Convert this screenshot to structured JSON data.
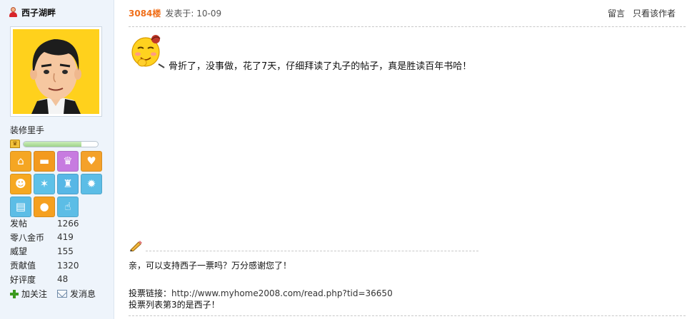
{
  "user": {
    "username": "西子湖畔",
    "title": "装修里手",
    "level_progress": 0.78,
    "medals": [
      {
        "icon": "house-icon",
        "color": "#f5a623"
      },
      {
        "icon": "sofa-icon",
        "color": "#f39a1e"
      },
      {
        "icon": "crown-icon",
        "color": "#c77be0"
      },
      {
        "icon": "heart-icon",
        "color": "#f4a12a"
      },
      {
        "icon": "bee-icon",
        "color": "#f6a821"
      },
      {
        "icon": "angel-icon",
        "color": "#5ec1e8"
      },
      {
        "icon": "trophy-icon",
        "color": "#57b7e6"
      },
      {
        "icon": "torch-icon",
        "color": "#5cbde6"
      },
      {
        "icon": "book-icon",
        "color": "#5cbde6"
      },
      {
        "icon": "water-drop-icon",
        "color": "#f5a020"
      },
      {
        "icon": "thumbs-up-icon",
        "color": "#5cbde6"
      }
    ],
    "stats": [
      {
        "label": "发帖",
        "value": "1266"
      },
      {
        "label": "零八金币",
        "value": "419"
      },
      {
        "label": "威望",
        "value": "155"
      },
      {
        "label": "贡献值",
        "value": "1320"
      },
      {
        "label": "好评度",
        "value": "48"
      }
    ],
    "actions": {
      "follow": "加关注",
      "message": "发消息"
    }
  },
  "post": {
    "floor": "3084楼",
    "posted": "发表于: 10-09",
    "links": {
      "reply": "留言",
      "only_author": "只看该作者"
    },
    "content": "骨折了，没事做，花了7天，仔细拜读了丸子的帖子，真是胜读百年书哈！",
    "signature": {
      "line1": "亲，可以支持西子一票吗？万分感谢您了！",
      "vote_label": "投票链接：",
      "vote_url": "http://www.myhome2008.com/read.php?tid=36650",
      "line3": "投票列表第3的是西子！"
    }
  },
  "colors": {
    "accent_orange": "#f06f1a",
    "sidebar_bg": "#eef4fb"
  }
}
